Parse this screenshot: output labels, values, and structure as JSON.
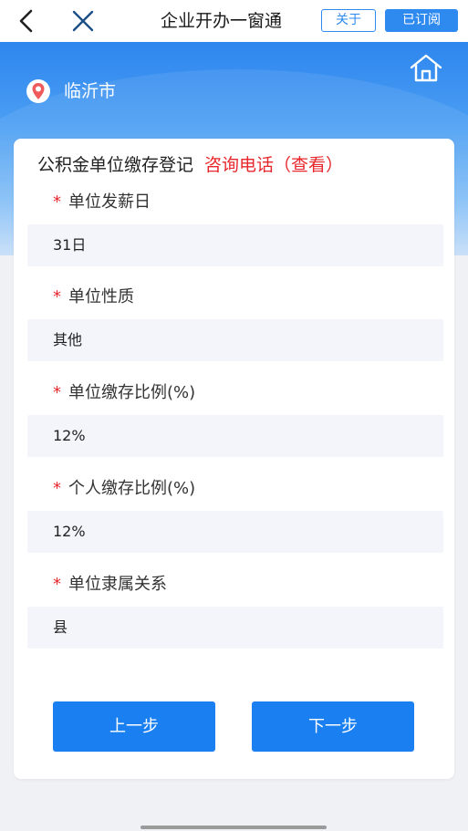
{
  "nav": {
    "back_icon": "chevron-left-icon",
    "close_icon": "close-icon",
    "title": "企业开办一窗通",
    "about_label": "关于",
    "subscribed_label": "已订阅"
  },
  "banner": {
    "city": "临沂市",
    "location_icon": "location-pin-icon",
    "home_icon": "home-icon"
  },
  "form": {
    "title": "公积金单位缴存登记",
    "hotline": "咨询电话（查看）",
    "required_mark": "*",
    "fields": [
      {
        "label": "单位发薪日",
        "value": "31日"
      },
      {
        "label": "单位性质",
        "value": "其他"
      },
      {
        "label": "单位缴存比例(%)",
        "value": "12%"
      },
      {
        "label": "个人缴存比例(%)",
        "value": "12%"
      },
      {
        "label": "单位隶属关系",
        "value": "县"
      }
    ],
    "prev_label": "上一步",
    "next_label": "下一步"
  },
  "colors": {
    "primary": "#1a7ff0",
    "required": "#e8272c",
    "banner": "#2e86ee"
  }
}
